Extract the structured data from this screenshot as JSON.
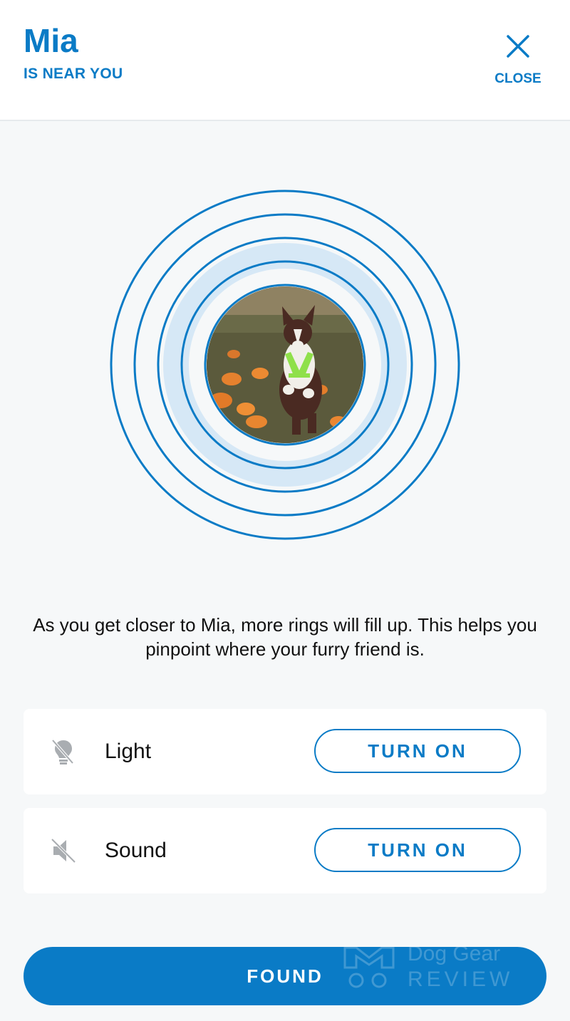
{
  "header": {
    "pet_name": "Mia",
    "status": "IS NEAR YOU",
    "close_label": "CLOSE",
    "close_icon": "close-icon"
  },
  "proximity": {
    "rings_total": 5,
    "rings_filled": 1,
    "pet_photo": "dog-photo"
  },
  "hint_text": "As you get closer to Mia, more rings will fill up. This helps you pinpoint where your furry friend is.",
  "controls": [
    {
      "icon": "light-off-icon",
      "label": "Light",
      "button": "TURN ON"
    },
    {
      "icon": "sound-off-icon",
      "label": "Sound",
      "button": "TURN ON"
    }
  ],
  "found_label": "FOUND",
  "watermark": {
    "line1": "Dog Gear",
    "line2": "REVIEW"
  },
  "colors": {
    "accent": "#0a7bc6",
    "ring_fill": "#d6e8f6",
    "background": "#f6f8f9",
    "card": "#ffffff",
    "icon_gray": "#a9adb1"
  }
}
